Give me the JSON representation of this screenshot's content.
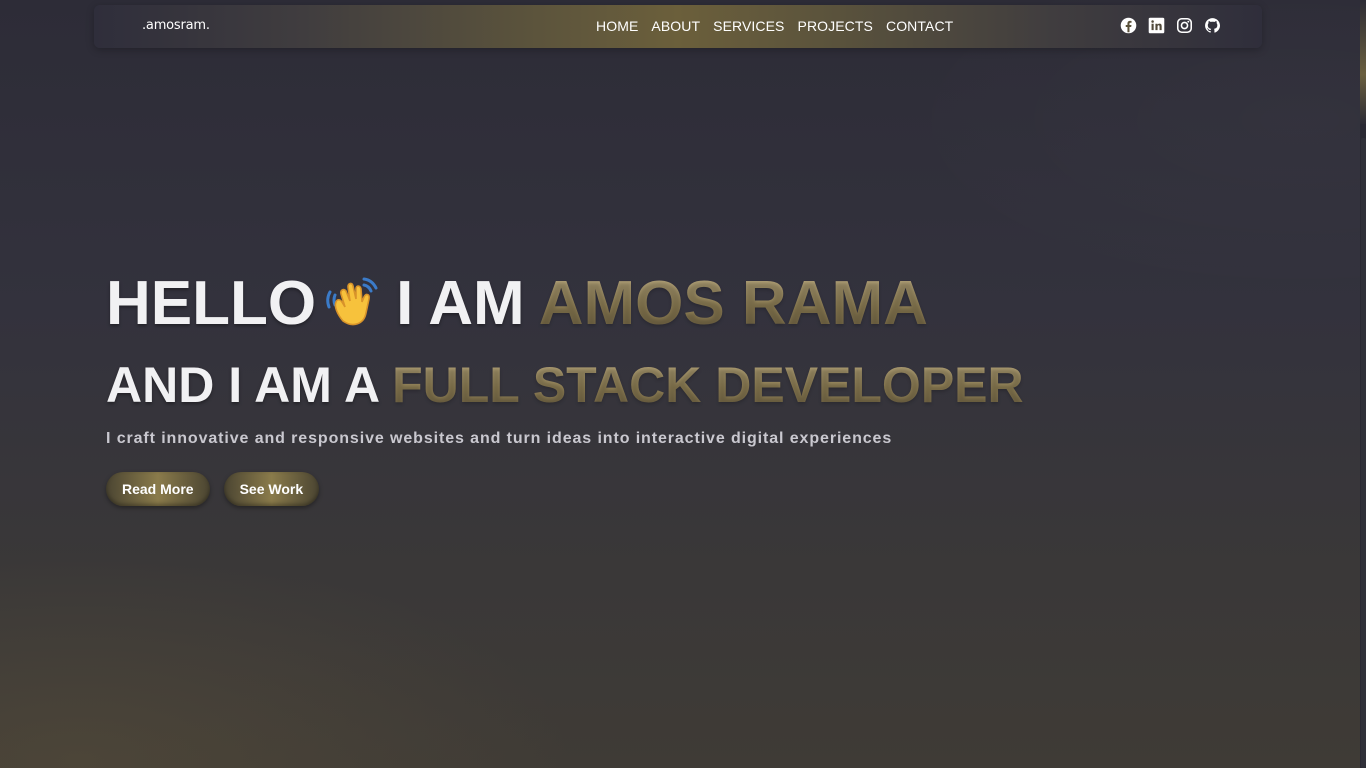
{
  "header": {
    "logo": ".amosram.",
    "nav": [
      "HOME",
      "ABOUT",
      "SERVICES",
      "PROJECTS",
      "CONTACT"
    ],
    "socials": [
      "facebook-icon",
      "linkedin-icon",
      "instagram-icon",
      "github-icon"
    ]
  },
  "hero": {
    "line1_a": "HELLO",
    "line1_emoji": "waving-hand-icon",
    "line1_b": "I AM",
    "line1_name": "AMOS RAMA",
    "line2_a": "AND I AM A",
    "line2_role": "FULL STACK DEVELOPER",
    "tagline": "I craft innovative and responsive websites and turn ideas into interactive digital experiences",
    "buttons": [
      "Read More",
      "See Work"
    ]
  },
  "colors": {
    "background": "#33323d",
    "accent_gold": "#8f7f55",
    "text": "#ffffff"
  }
}
